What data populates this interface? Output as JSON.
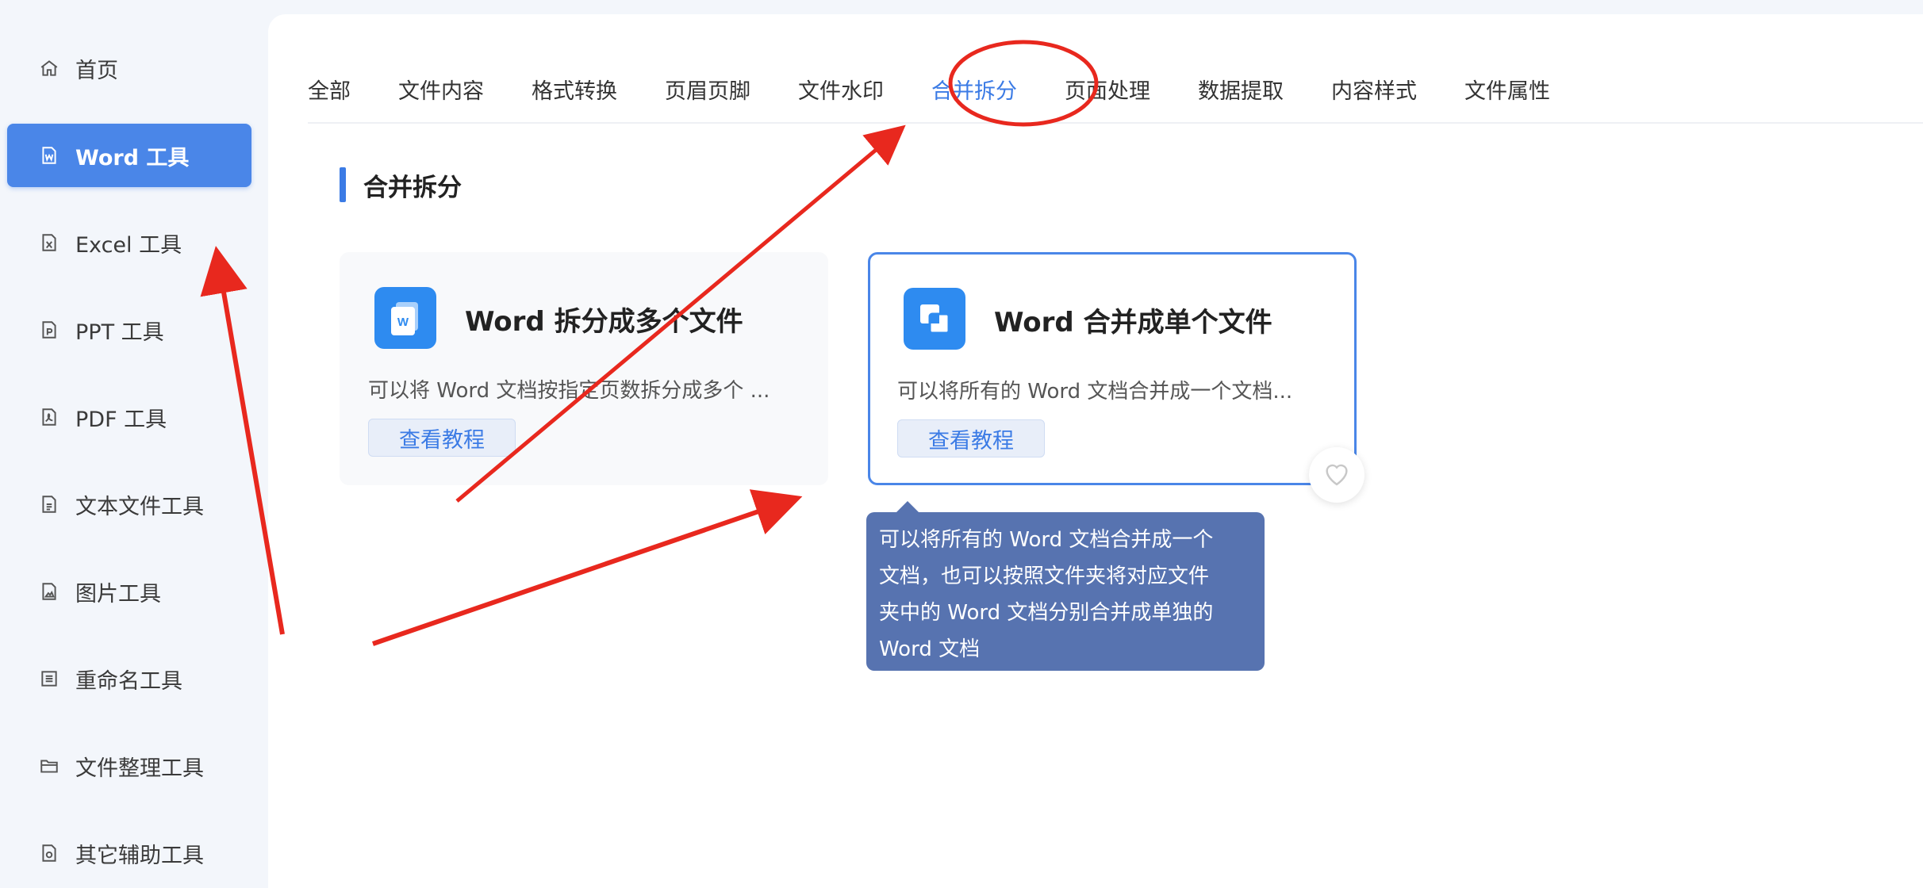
{
  "sidebar": {
    "items": [
      {
        "label": "首页",
        "icon": "home-icon",
        "active": false
      },
      {
        "label": "Word 工具",
        "icon": "word-file-icon",
        "active": true
      },
      {
        "label": "Excel 工具",
        "icon": "excel-file-icon",
        "active": false
      },
      {
        "label": "PPT 工具",
        "icon": "ppt-file-icon",
        "active": false
      },
      {
        "label": "PDF 工具",
        "icon": "pdf-file-icon",
        "active": false
      },
      {
        "label": "文本文件工具",
        "icon": "text-file-icon",
        "active": false
      },
      {
        "label": "图片工具",
        "icon": "image-file-icon",
        "active": false
      },
      {
        "label": "重命名工具",
        "icon": "rename-icon",
        "active": false
      },
      {
        "label": "文件整理工具",
        "icon": "folder-icon",
        "active": false
      },
      {
        "label": "其它辅助工具",
        "icon": "tools-icon",
        "active": false
      }
    ]
  },
  "tabs": [
    {
      "label": "全部"
    },
    {
      "label": "文件内容"
    },
    {
      "label": "格式转换"
    },
    {
      "label": "页眉页脚"
    },
    {
      "label": "文件水印"
    },
    {
      "label": "合并拆分",
      "active": true
    },
    {
      "label": "页面处理"
    },
    {
      "label": "数据提取"
    },
    {
      "label": "内容样式"
    },
    {
      "label": "文件属性"
    }
  ],
  "section": {
    "title": "合并拆分"
  },
  "cards": [
    {
      "title": "Word 拆分成多个文件",
      "desc": "可以将 Word 文档按指定页数拆分成多个 ...",
      "button": "查看教程",
      "icon": "word-split-icon",
      "icon_letter": "W"
    },
    {
      "title": "Word 合并成单个文件",
      "desc": "可以将所有的 Word 文档合并成一个文档...",
      "button": "查看教程",
      "icon": "word-merge-icon"
    }
  ],
  "tooltip": {
    "lines": [
      "可以将所有的 Word 文档合并成一个",
      "文档，也可以按照文件夹将对应文件",
      "夹中的 Word 文档分别合并成单独的",
      "Word 文档"
    ]
  },
  "colors": {
    "accent": "#4a86e8",
    "annotation": "#e8281e",
    "tooltip_bg": "#5773b0"
  }
}
